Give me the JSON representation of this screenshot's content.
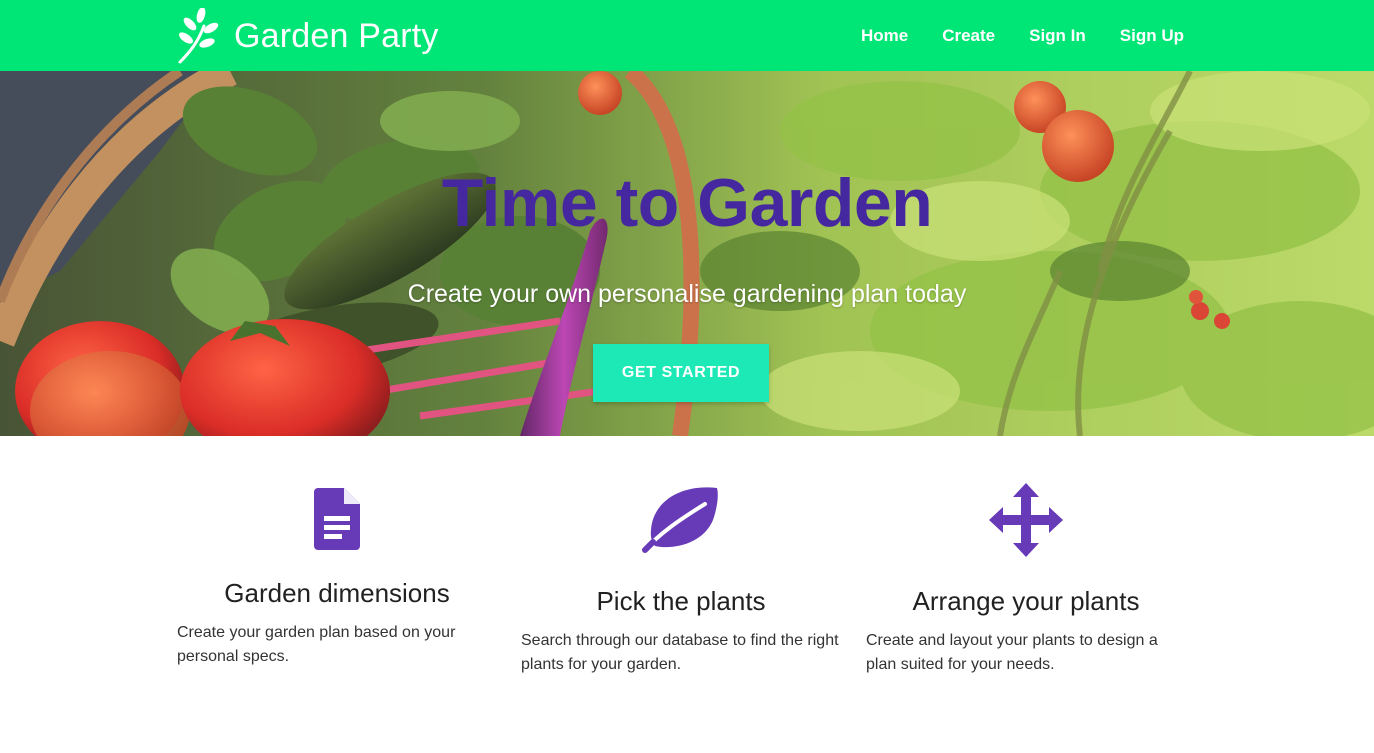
{
  "navbar": {
    "brand_name": "Garden Party",
    "brand_icon": "leaf-sprig-icon",
    "links": [
      {
        "label": "Home"
      },
      {
        "label": "Create"
      },
      {
        "label": "Sign In"
      },
      {
        "label": "Sign Up"
      }
    ]
  },
  "hero": {
    "title": "Time to Garden",
    "subtitle": "Create your own personalise gardening plan today",
    "button_label": "GET STARTED"
  },
  "features": [
    {
      "icon": "document-icon",
      "title": "Garden dimensions",
      "text": "Create your garden plan based on your personal specs."
    },
    {
      "icon": "leaf-icon",
      "title": "Pick the plants",
      "text": "Search through our database to find the right plants for your garden."
    },
    {
      "icon": "move-arrows-icon",
      "title": "Arrange your plants",
      "text": "Create and layout your plants to design a plan suited for your needs."
    }
  ],
  "colors": {
    "navbar": "#00e676",
    "hero_title": "#4527a0",
    "button": "#1de9b6",
    "icon": "#673ab7"
  }
}
